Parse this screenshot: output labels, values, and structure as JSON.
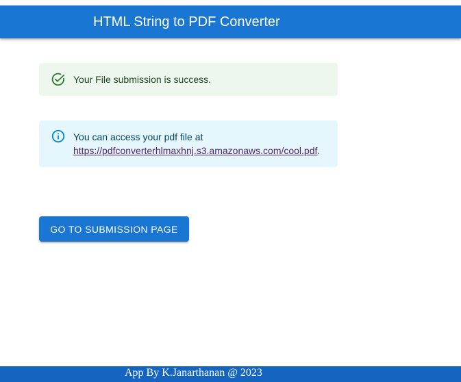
{
  "app_bar": {
    "title": "HTML String to PDF Converter",
    "color": "#1976d2"
  },
  "alerts": {
    "success": {
      "icon": "check-circle-icon",
      "message": "Your File submission is success.",
      "color": "#2e7d32",
      "background": "#edf7ed"
    },
    "info": {
      "icon": "info-icon",
      "message": "You can access your pdf file at",
      "link_text": "https://pdfconverterhlmaxhnj.s3.amazonaws.com/cool.pdf",
      "trailing": ".",
      "color": "#0288d1",
      "background": "#e5f6fd"
    }
  },
  "actions": {
    "go_to_submission_label": "GO TO SUBMISSION PAGE"
  },
  "footer": {
    "text": "App By K.Janarthanan @ 2023",
    "color": "#1565c0"
  }
}
